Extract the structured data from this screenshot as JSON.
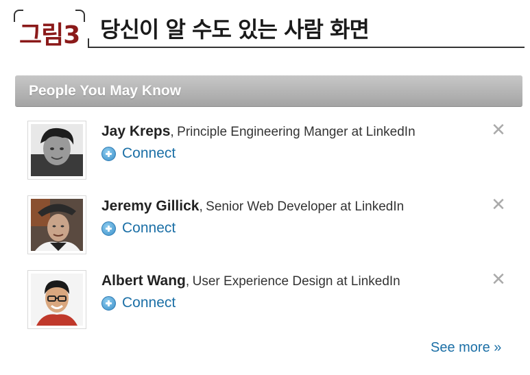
{
  "figure": {
    "tag": "그림3",
    "title": "당신이 알 수도 있는 사람 화면"
  },
  "widget": {
    "header": "People You May Know",
    "people": [
      {
        "name": "Jay Kreps",
        "separator": ",",
        "title": "Principle Engineering Manger at LinkedIn",
        "connect_label": "Connect",
        "dismiss": "✕"
      },
      {
        "name": "Jeremy Gillick",
        "separator": ",",
        "title": "Senior Web Developer at LinkedIn",
        "connect_label": "Connect",
        "dismiss": "✕"
      },
      {
        "name": "Albert Wang",
        "separator": ",",
        "title": "User Experience Design at LinkedIn",
        "connect_label": "Connect",
        "dismiss": "✕"
      }
    ],
    "see_more": "See more »"
  },
  "colors": {
    "tag": "#8b1a1a",
    "link": "#1b6fa6",
    "header_bg": "#b3b3b3",
    "dismiss": "#aaaaaa"
  }
}
